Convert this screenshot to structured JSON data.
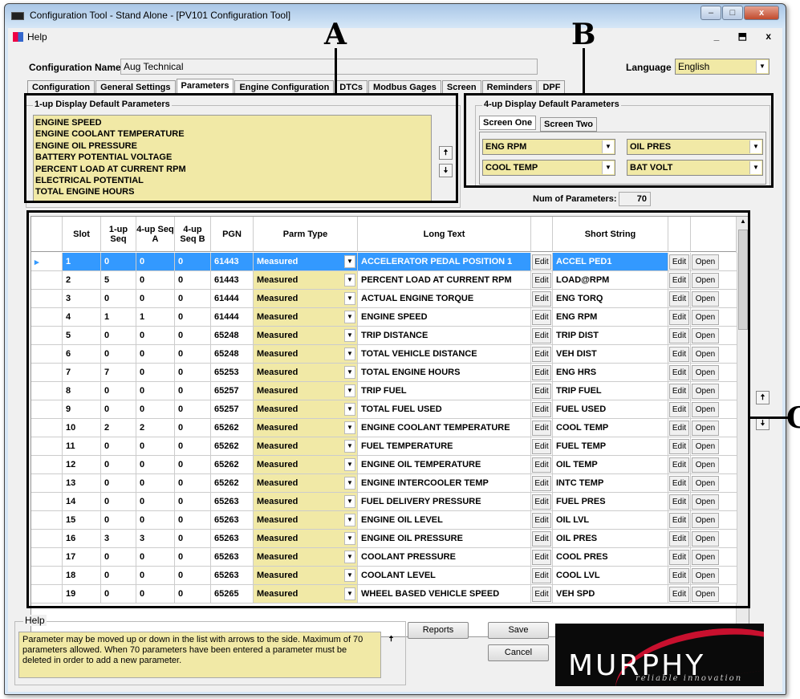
{
  "window": {
    "title": "Configuration Tool - Stand Alone - [PV101 Configuration Tool]",
    "minimize": "–",
    "maximize": "□",
    "close": "x"
  },
  "menu": {
    "help": "Help",
    "mdi_controls": "_ ⬒ x"
  },
  "config": {
    "name_label": "Configuration Name:",
    "name_value": "Aug Technical",
    "language_label": "Language",
    "language_value": "English"
  },
  "tabs": [
    "Configuration",
    "General Settings",
    "Parameters",
    "Engine Configuration",
    "DTCs",
    "Modbus Gages",
    "Screen",
    "Reminders",
    "DPF"
  ],
  "active_tab": "Parameters",
  "oneup": {
    "title": "1-up Display Default Parameters",
    "items": [
      "ENGINE SPEED",
      "ENGINE COOLANT TEMPERATURE",
      "ENGINE OIL PRESSURE",
      "BATTERY POTENTIAL VOLTAGE",
      "PERCENT LOAD AT CURRENT RPM",
      "ELECTRICAL POTENTIAL",
      "TOTAL ENGINE HOURS"
    ]
  },
  "fourup": {
    "title": "4-up Display Default Parameters",
    "tabs": [
      "Screen One",
      "Screen Two"
    ],
    "combos": [
      "ENG RPM",
      "OIL PRES",
      "COOL TEMP",
      "BAT VOLT"
    ]
  },
  "num_params": {
    "label": "Num of Parameters:",
    "value": "70"
  },
  "grid": {
    "headers": [
      "",
      "Slot",
      "1-up Seq",
      "4-up Seq A",
      "4-up Seq B",
      "PGN",
      "Parm Type",
      "Long Text",
      "",
      "Short String",
      "",
      ""
    ],
    "edit_label": "Edit",
    "open_label": "Open",
    "rows": [
      [
        "1",
        "0",
        "0",
        "0",
        "61443",
        "Measured",
        "ACCELERATOR PEDAL POSITION 1",
        "ACCEL PED1"
      ],
      [
        "2",
        "5",
        "0",
        "0",
        "61443",
        "Measured",
        "PERCENT LOAD AT CURRENT RPM",
        "LOAD@RPM"
      ],
      [
        "3",
        "0",
        "0",
        "0",
        "61444",
        "Measured",
        "ACTUAL ENGINE TORQUE",
        "ENG TORQ"
      ],
      [
        "4",
        "1",
        "1",
        "0",
        "61444",
        "Measured",
        "ENGINE SPEED",
        "ENG RPM"
      ],
      [
        "5",
        "0",
        "0",
        "0",
        "65248",
        "Measured",
        "TRIP DISTANCE",
        "TRIP DIST"
      ],
      [
        "6",
        "0",
        "0",
        "0",
        "65248",
        "Measured",
        "TOTAL VEHICLE DISTANCE",
        "VEH DIST"
      ],
      [
        "7",
        "7",
        "0",
        "0",
        "65253",
        "Measured",
        "TOTAL ENGINE HOURS",
        "ENG HRS"
      ],
      [
        "8",
        "0",
        "0",
        "0",
        "65257",
        "Measured",
        "TRIP FUEL",
        "TRIP FUEL"
      ],
      [
        "9",
        "0",
        "0",
        "0",
        "65257",
        "Measured",
        "TOTAL FUEL USED",
        "FUEL USED"
      ],
      [
        "10",
        "2",
        "2",
        "0",
        "65262",
        "Measured",
        "ENGINE COOLANT TEMPERATURE",
        "COOL TEMP"
      ],
      [
        "11",
        "0",
        "0",
        "0",
        "65262",
        "Measured",
        "FUEL TEMPERATURE",
        "FUEL TEMP"
      ],
      [
        "12",
        "0",
        "0",
        "0",
        "65262",
        "Measured",
        "ENGINE OIL TEMPERATURE",
        "OIL TEMP"
      ],
      [
        "13",
        "0",
        "0",
        "0",
        "65262",
        "Measured",
        "ENGINE INTERCOOLER TEMP",
        "INTC TEMP"
      ],
      [
        "14",
        "0",
        "0",
        "0",
        "65263",
        "Measured",
        "FUEL DELIVERY PRESSURE",
        "FUEL PRES"
      ],
      [
        "15",
        "0",
        "0",
        "0",
        "65263",
        "Measured",
        "ENGINE OIL LEVEL",
        "OIL LVL"
      ],
      [
        "16",
        "3",
        "3",
        "0",
        "65263",
        "Measured",
        "ENGINE OIL PRESSURE",
        "OIL PRES"
      ],
      [
        "17",
        "0",
        "0",
        "0",
        "65263",
        "Measured",
        "COOLANT PRESSURE",
        "COOL PRES"
      ],
      [
        "18",
        "0",
        "0",
        "0",
        "65263",
        "Measured",
        "COOLANT LEVEL",
        "COOL LVL"
      ],
      [
        "19",
        "0",
        "0",
        "0",
        "65265",
        "Measured",
        "WHEEL BASED VEHICLE SPEED",
        "VEH SPD"
      ]
    ],
    "selected_row": 0
  },
  "help": {
    "title": "Help",
    "text": "Parameter may be moved up or down in the list with arrows to the side.  Maximum of 70 parameters allowed.  When 70 parameters have been entered a parameter must be deleted in order to add a new parameter."
  },
  "buttons": {
    "reports": "Reports",
    "save": "Save",
    "cancel": "Cancel"
  },
  "logo": {
    "brand": "MURPHY",
    "tagline": "reliable innovation"
  },
  "annotations": {
    "a": "A",
    "b": "B",
    "c": "C"
  },
  "icons": {
    "up": "up-arrow-icon",
    "down": "down-arrow-icon",
    "dropdown": "chevron-down-icon"
  },
  "colors": {
    "field_yellow": "#f1e9a6",
    "selection": "#3399ff",
    "brand_red": "#c8102e"
  }
}
